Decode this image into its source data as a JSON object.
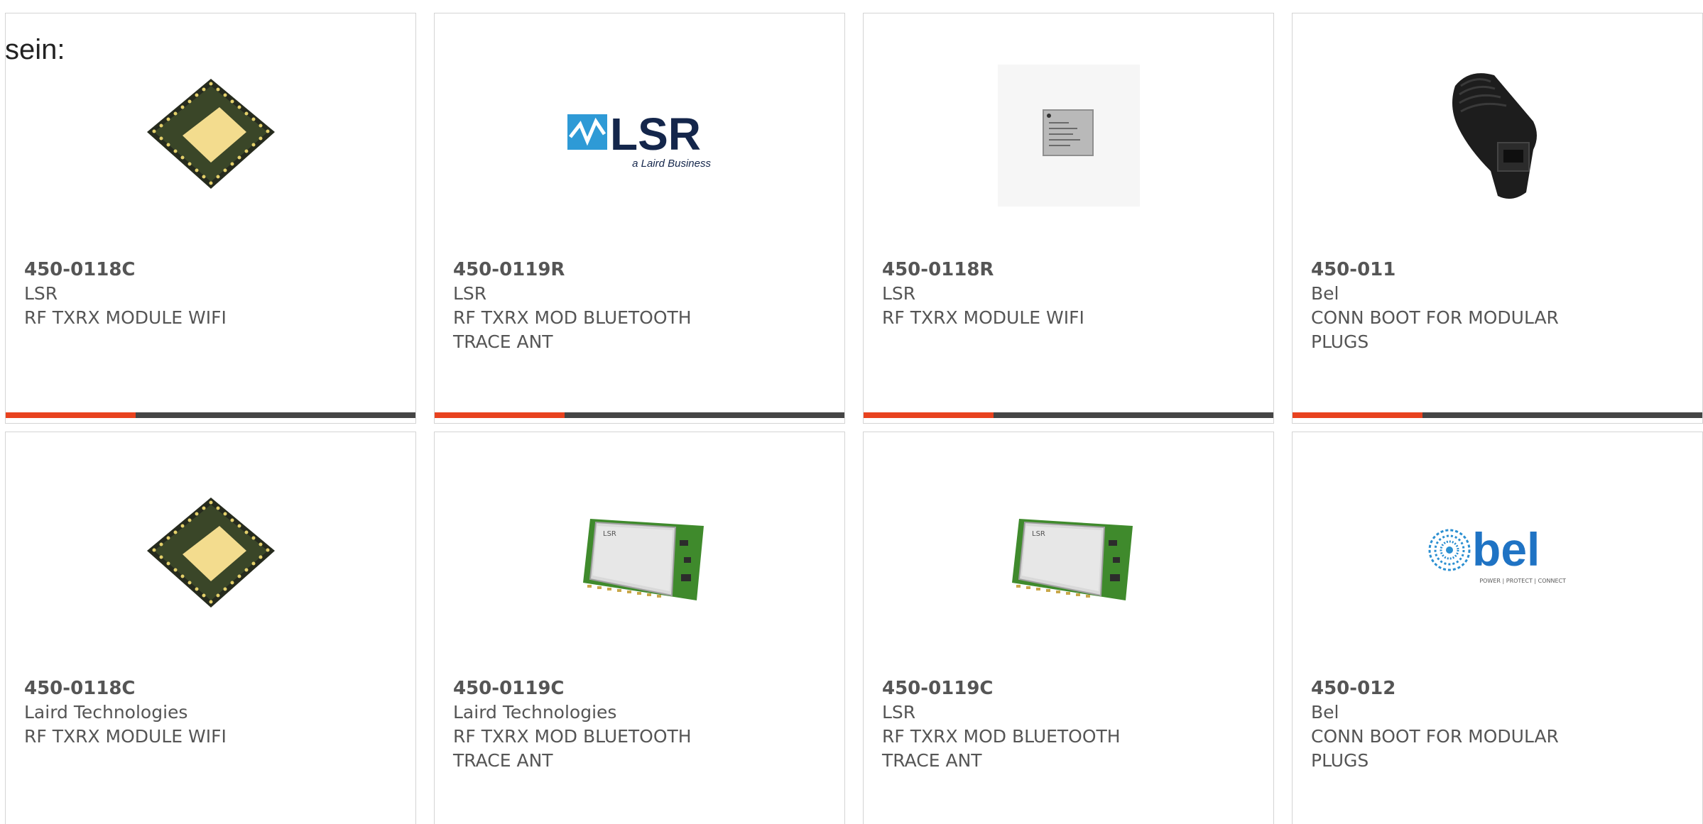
{
  "leadin_text": "sein:",
  "accent_color": "#e8421f",
  "bar_color": "#454545",
  "products": [
    {
      "part_number": "450-0118C",
      "manufacturer": "LSR",
      "description": "RF TXRX MODULE WIFI",
      "image": "qfn-chip-icon"
    },
    {
      "part_number": "450-0119R",
      "manufacturer": "LSR",
      "description": "RF TXRX MOD BLUETOOTH TRACE ANT",
      "image": "lsr-logo",
      "logo_text": "LSR",
      "logo_subtext": "a Laird Business"
    },
    {
      "part_number": "450-0118R",
      "manufacturer": "LSR",
      "description": "RF TXRX MODULE WIFI",
      "image": "small-module-icon"
    },
    {
      "part_number": "450-011",
      "manufacturer": "Bel",
      "description": "CONN BOOT FOR MODULAR PLUGS",
      "image": "modular-plug-boot-icon"
    },
    {
      "part_number": "450-0118C",
      "manufacturer": "Laird Technologies",
      "description": "RF TXRX MODULE WIFI",
      "image": "qfn-chip-icon"
    },
    {
      "part_number": "450-0119C",
      "manufacturer": "Laird Technologies",
      "description": "RF TXRX MOD BLUETOOTH TRACE ANT",
      "image": "pcb-module-icon",
      "module_label": "LSR"
    },
    {
      "part_number": "450-0119C",
      "manufacturer": "LSR",
      "description": "RF TXRX MOD BLUETOOTH TRACE ANT",
      "image": "pcb-module-icon",
      "module_label": "LSR"
    },
    {
      "part_number": "450-012",
      "manufacturer": "Bel",
      "description": "CONN BOOT FOR MODULAR PLUGS",
      "image": "bel-logo",
      "logo_text": "bel",
      "logo_subtext": "POWER | PROTECT | CONNECT"
    }
  ]
}
